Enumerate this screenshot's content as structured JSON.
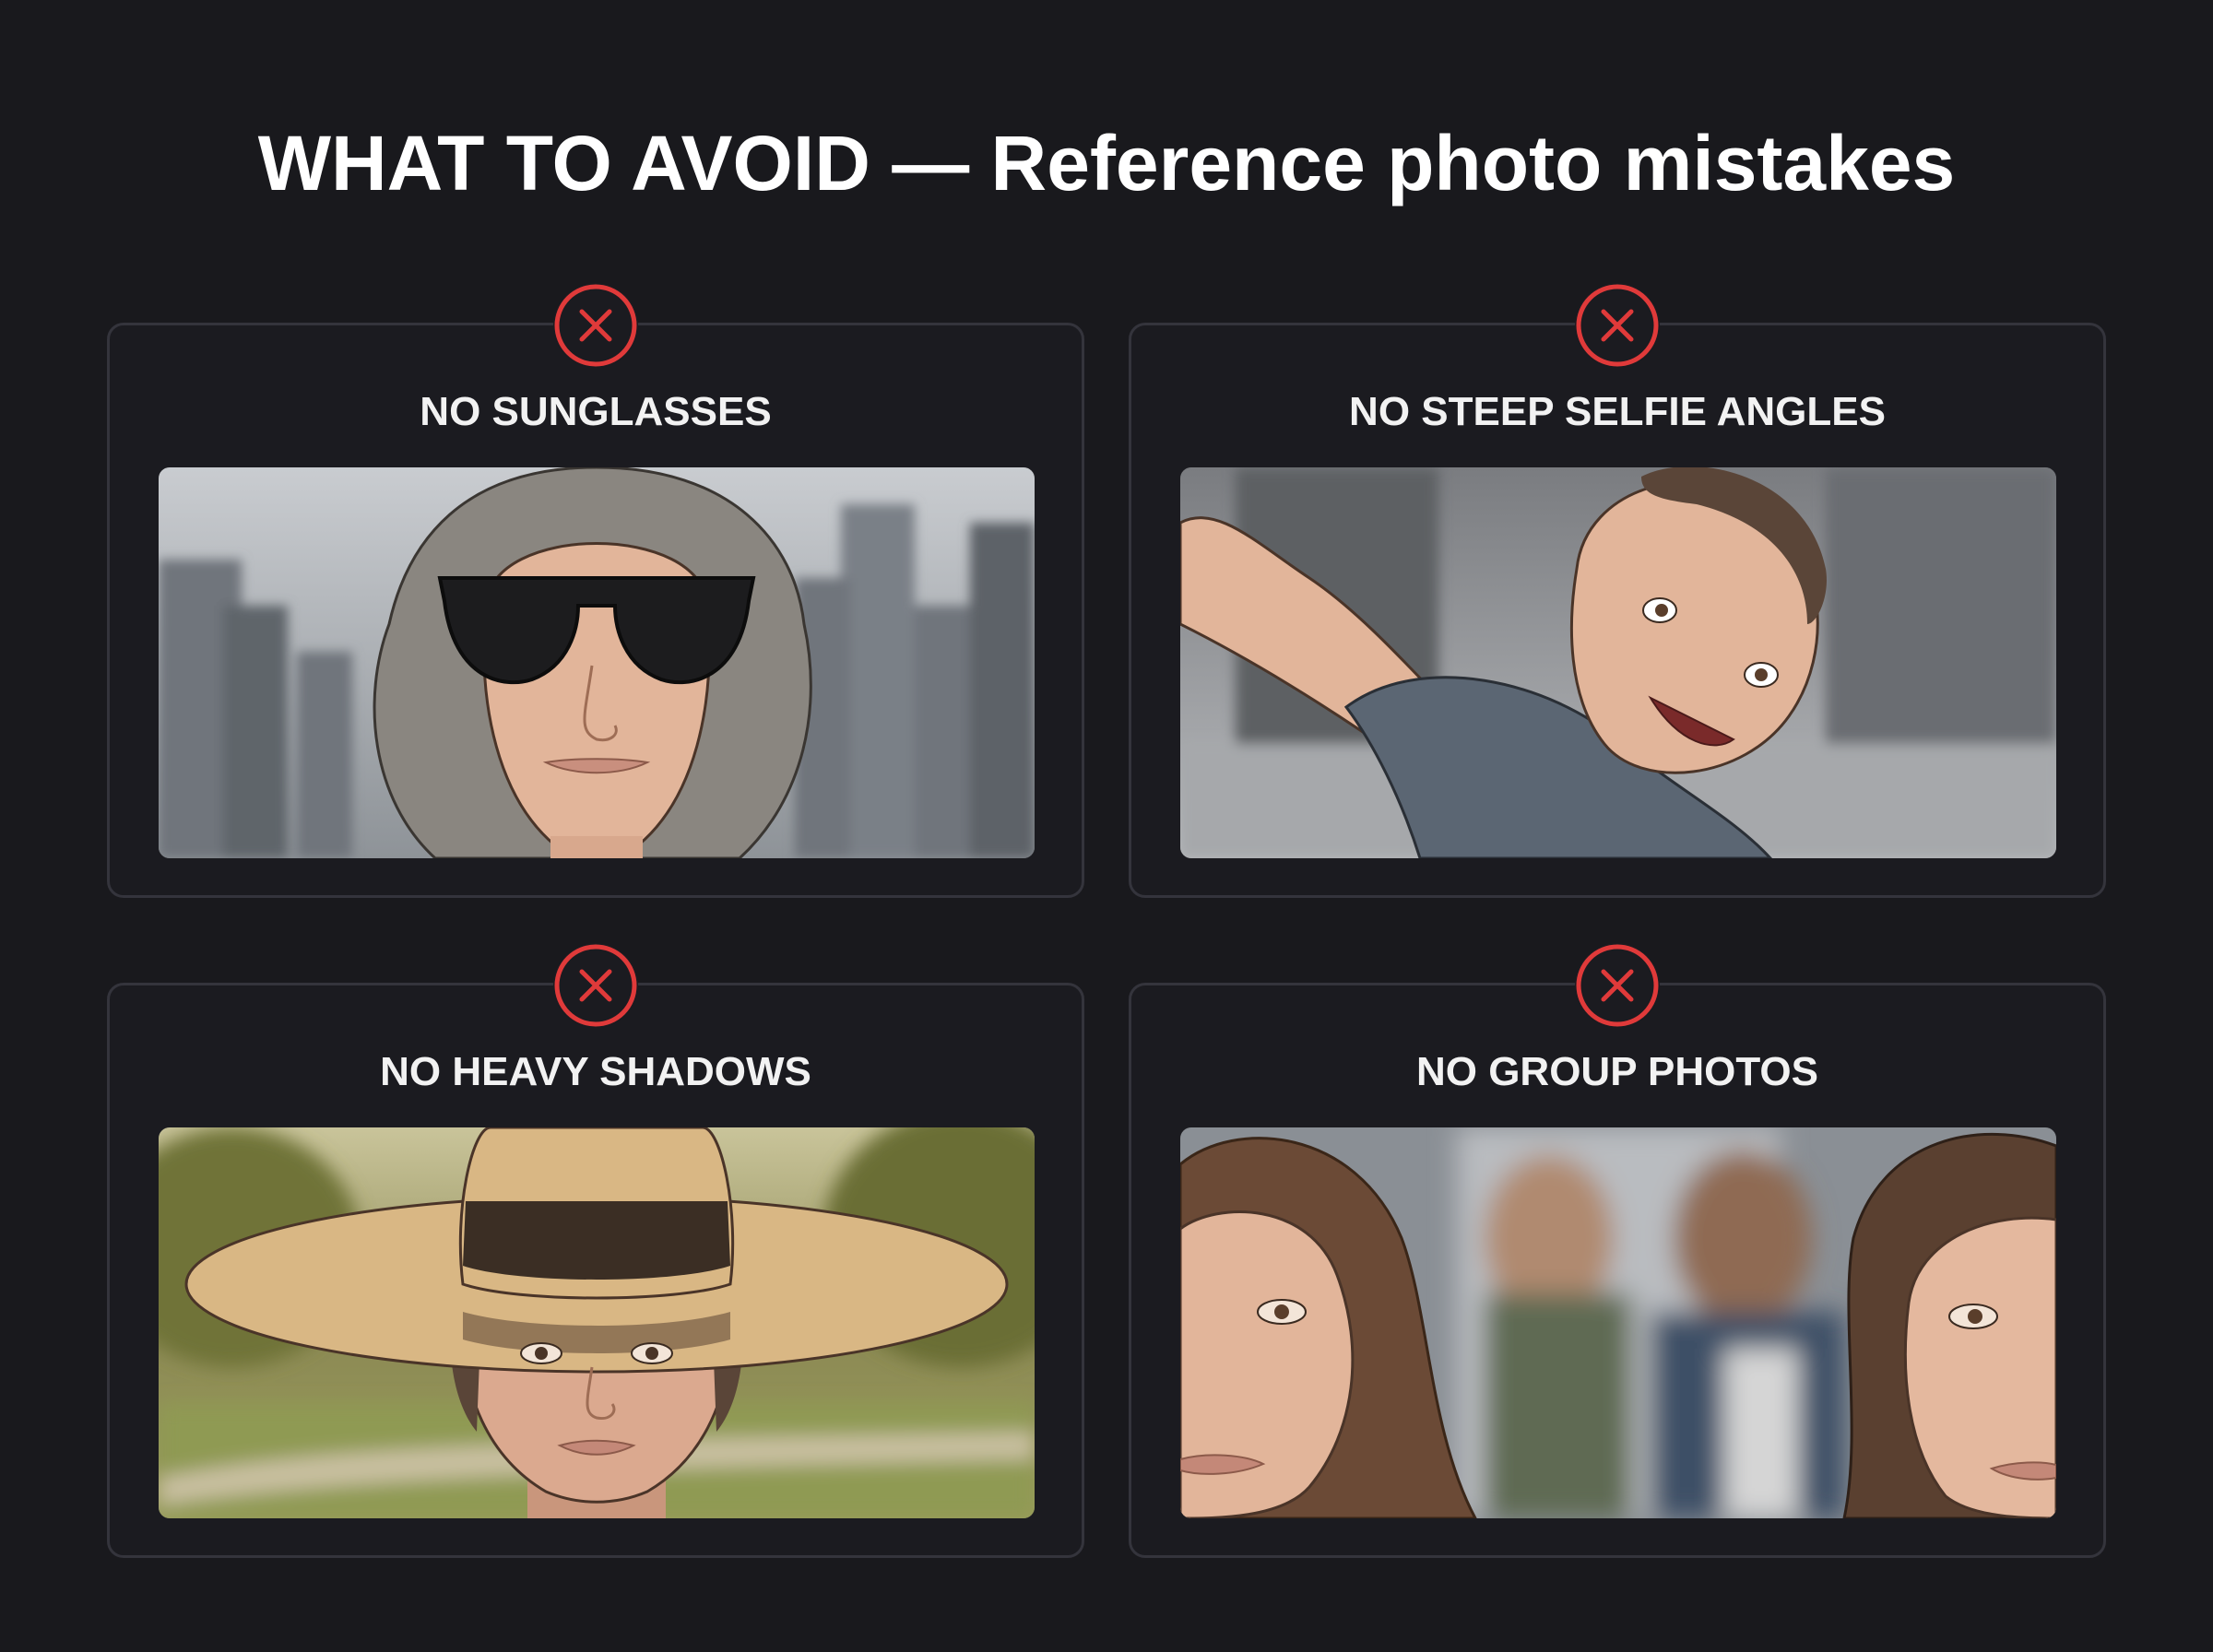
{
  "title": "WHAT TO AVOID — Reference photo mistakes",
  "colors": {
    "background": "#19191d",
    "card_border": "#34343c",
    "badge_red": "#e03a3a"
  },
  "cards": [
    {
      "label": "NO SUNGLASSES",
      "icon": "x-circle-icon",
      "image": "woman-wearing-sunglasses-illustration"
    },
    {
      "label": "NO STEEP SELFIE ANGLES",
      "icon": "x-circle-icon",
      "image": "man-taking-angled-selfie-illustration"
    },
    {
      "label": "NO HEAVY SHADOWS",
      "icon": "x-circle-icon",
      "image": "woman-with-wide-brim-hat-shadow-illustration"
    },
    {
      "label": "NO GROUP PHOTOS",
      "icon": "x-circle-icon",
      "image": "group-photo-cropped-faces-illustration"
    }
  ]
}
